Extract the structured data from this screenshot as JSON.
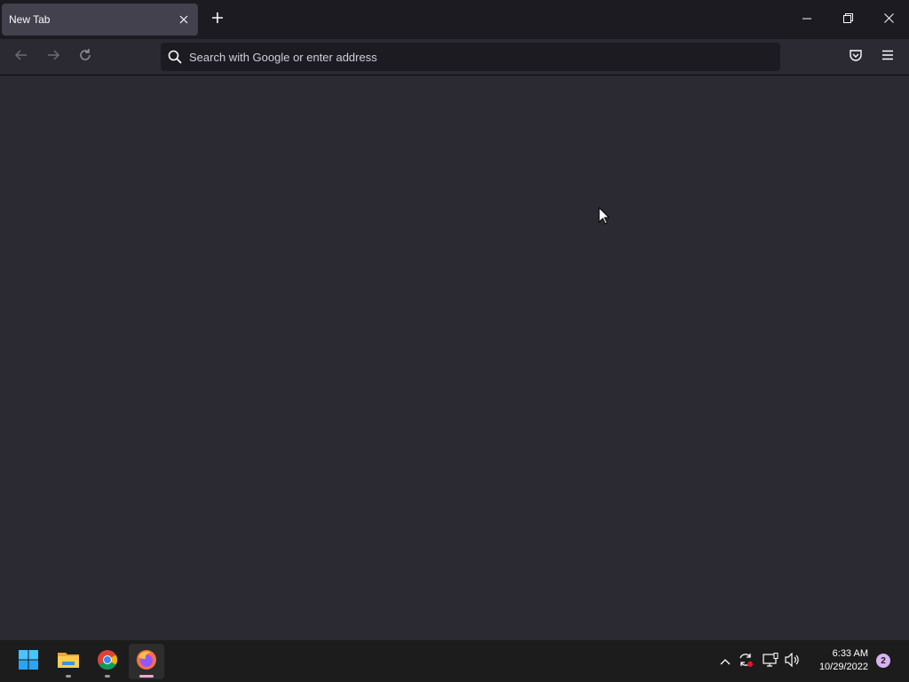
{
  "browser": {
    "tab": {
      "title": "New Tab",
      "close_icon": "close-icon"
    },
    "new_tab_icon": "plus-icon",
    "window_controls": [
      "minimize-icon",
      "restore-icon",
      "close-icon"
    ],
    "nav": {
      "back_icon": "back-arrow-icon",
      "forward_icon": "forward-arrow-icon",
      "reload_icon": "reload-icon"
    },
    "urlbar": {
      "placeholder": "Search with Google or enter address",
      "value": "",
      "icon": "search-icon"
    },
    "toolbar_icons": [
      "pocket-icon",
      "hamburger-menu-icon"
    ]
  },
  "taskbar": {
    "apps": [
      {
        "name": "Start",
        "icon": "windows-start-icon",
        "running": false
      },
      {
        "name": "File Explorer",
        "icon": "file-explorer-icon",
        "running": true
      },
      {
        "name": "Google Chrome",
        "icon": "chrome-icon",
        "running": true
      },
      {
        "name": "Firefox",
        "icon": "firefox-icon",
        "running": true,
        "active": true
      }
    ],
    "tray_icons": [
      "chevron-up-icon",
      "sync-icon",
      "network-icon",
      "volume-icon"
    ],
    "time": "6:33 AM",
    "date": "10/29/2022",
    "notification_count": "2"
  },
  "colors": {
    "tabbar_bg": "#1c1b22",
    "tab_active_bg": "#42414d",
    "toolbar_bg": "#2b2a33",
    "urlbar_bg": "#1c1b22",
    "content_bg": "#2b2a33",
    "taskbar_bg": "#1c1c1c",
    "active_indicator": "#f7a8d0"
  }
}
